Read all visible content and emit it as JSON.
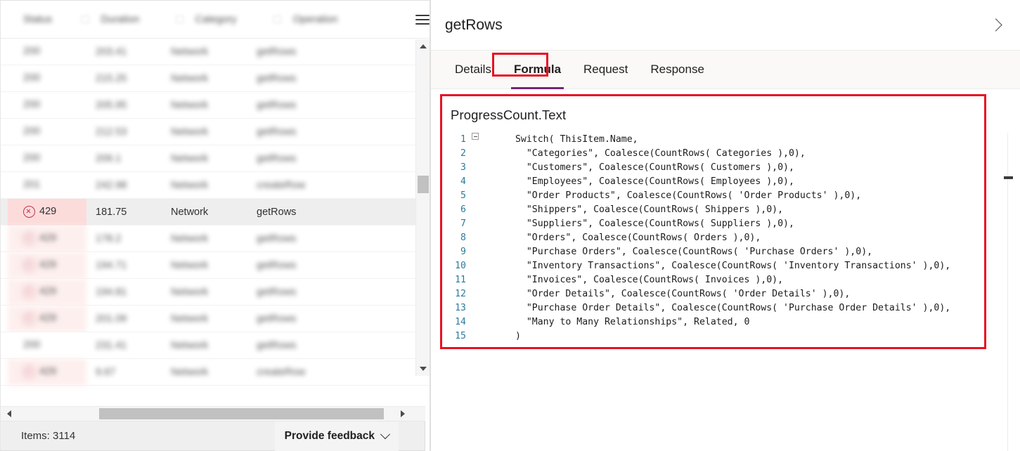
{
  "grid": {
    "columns": [
      "Status",
      "Duration",
      "Category",
      "Operation"
    ],
    "menu_icon": "hamburger-menu-icon",
    "rows": [
      {
        "status": "200",
        "duration": "203.41",
        "category": "Network",
        "operation": "getRows",
        "error": false,
        "blurred": true,
        "selected": false
      },
      {
        "status": "200",
        "duration": "215.25",
        "category": "Network",
        "operation": "getRows",
        "error": false,
        "blurred": true,
        "selected": false
      },
      {
        "status": "200",
        "duration": "205.95",
        "category": "Network",
        "operation": "getRows",
        "error": false,
        "blurred": true,
        "selected": false
      },
      {
        "status": "200",
        "duration": "212.53",
        "category": "Network",
        "operation": "getRows",
        "error": false,
        "blurred": true,
        "selected": false
      },
      {
        "status": "200",
        "duration": "209.1",
        "category": "Network",
        "operation": "getRows",
        "error": false,
        "blurred": true,
        "selected": false
      },
      {
        "status": "201",
        "duration": "242.98",
        "category": "Network",
        "operation": "createRow",
        "error": false,
        "blurred": true,
        "selected": false
      },
      {
        "status": "429",
        "duration": "181.75",
        "category": "Network",
        "operation": "getRows",
        "error": true,
        "blurred": false,
        "selected": true
      },
      {
        "status": "429",
        "duration": "178.2",
        "category": "Network",
        "operation": "getRows",
        "error": true,
        "blurred": true,
        "selected": false
      },
      {
        "status": "429",
        "duration": "194.71",
        "category": "Network",
        "operation": "getRows",
        "error": true,
        "blurred": true,
        "selected": false
      },
      {
        "status": "429",
        "duration": "194.81",
        "category": "Network",
        "operation": "getRows",
        "error": true,
        "blurred": true,
        "selected": false
      },
      {
        "status": "429",
        "duration": "201.09",
        "category": "Network",
        "operation": "getRows",
        "error": true,
        "blurred": true,
        "selected": false
      },
      {
        "status": "200",
        "duration": "231.41",
        "category": "Network",
        "operation": "getRows",
        "error": false,
        "blurred": true,
        "selected": false
      },
      {
        "status": "429",
        "duration": "9.67",
        "category": "Network",
        "operation": "createRow",
        "error": true,
        "blurred": true,
        "selected": false
      }
    ]
  },
  "status_bar": {
    "items_label": "Items: 3114",
    "feedback_label": "Provide feedback",
    "feedback_chevron": "chevron-down-icon"
  },
  "detail": {
    "title": "getRows",
    "expand_icon": "chevron-right-icon",
    "tabs": [
      {
        "label": "Details",
        "active": false
      },
      {
        "label": "Formula",
        "active": true
      },
      {
        "label": "Request",
        "active": false
      },
      {
        "label": "Response",
        "active": false
      }
    ],
    "formula": {
      "property_name": "ProgressCount.Text",
      "lines": [
        {
          "n": "1",
          "text": "Switch( ThisItem.Name,",
          "fold": true,
          "indent": 0
        },
        {
          "n": "2",
          "text": "\"Categories\", Coalesce(CountRows( Categories ),0),",
          "fold": false,
          "indent": 2
        },
        {
          "n": "3",
          "text": "\"Customers\", Coalesce(CountRows( Customers ),0),",
          "fold": false,
          "indent": 2
        },
        {
          "n": "4",
          "text": "\"Employees\", Coalesce(CountRows( Employees ),0),",
          "fold": false,
          "indent": 2
        },
        {
          "n": "5",
          "text": "\"Order Products\", Coalesce(CountRows( 'Order Products' ),0),",
          "fold": false,
          "indent": 2
        },
        {
          "n": "6",
          "text": "\"Shippers\", Coalesce(CountRows( Shippers ),0),",
          "fold": false,
          "indent": 2
        },
        {
          "n": "7",
          "text": "\"Suppliers\", Coalesce(CountRows( Suppliers ),0),",
          "fold": false,
          "indent": 2
        },
        {
          "n": "8",
          "text": "\"Orders\", Coalesce(CountRows( Orders ),0),",
          "fold": false,
          "indent": 2
        },
        {
          "n": "9",
          "text": "\"Purchase Orders\", Coalesce(CountRows( 'Purchase Orders' ),0),",
          "fold": false,
          "indent": 2
        },
        {
          "n": "10",
          "text": "\"Inventory Transactions\", Coalesce(CountRows( 'Inventory Transactions' ),0),",
          "fold": false,
          "indent": 2
        },
        {
          "n": "11",
          "text": "\"Invoices\", Coalesce(CountRows( Invoices ),0),",
          "fold": false,
          "indent": 2
        },
        {
          "n": "12",
          "text": "\"Order Details\", Coalesce(CountRows( 'Order Details' ),0),",
          "fold": false,
          "indent": 2
        },
        {
          "n": "13",
          "text": "\"Purchase Order Details\", Coalesce(CountRows( 'Purchase Order Details' ),0),",
          "fold": false,
          "indent": 2
        },
        {
          "n": "14",
          "text": "\"Many to Many Relationships\", Related, 0",
          "fold": false,
          "indent": 2
        },
        {
          "n": "15",
          "text": ")",
          "fold": false,
          "indent": 0
        }
      ]
    }
  },
  "colors": {
    "error_red": "#c4314b",
    "highlight_red": "#e81123",
    "tab_accent": "#742774",
    "error_row_bg": "#fdecea"
  }
}
